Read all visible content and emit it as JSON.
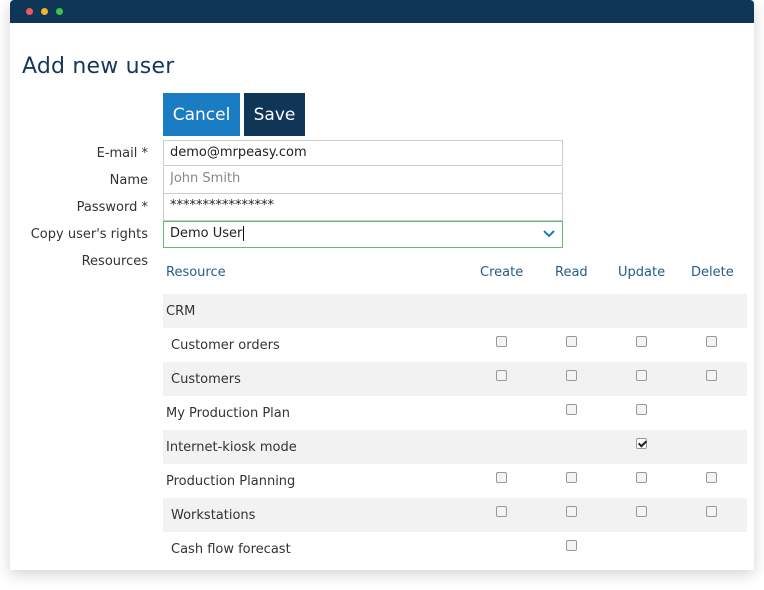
{
  "window": {
    "title_controls": [
      "close",
      "minimize",
      "zoom"
    ]
  },
  "page": {
    "title": "Add new user"
  },
  "toolbar": {
    "cancel_label": "Cancel",
    "save_label": "Save"
  },
  "form": {
    "email_label": "E-mail *",
    "email_value": "demo@mrpeasy.com",
    "name_label": "Name",
    "name_placeholder": "John Smith",
    "password_label": "Password *",
    "password_value": "****************",
    "copy_rights_label": "Copy user's rights",
    "copy_rights_value": "Demo User",
    "resources_label": "Resources"
  },
  "resources_table": {
    "columns": [
      "Resource",
      "Create",
      "Read",
      "Update",
      "Delete"
    ],
    "rows": [
      {
        "label": "CRM",
        "indent": false,
        "checks": [
          null,
          null,
          null,
          null
        ]
      },
      {
        "label": "Customer orders",
        "indent": true,
        "checks": [
          false,
          false,
          false,
          false
        ]
      },
      {
        "label": "Customers",
        "indent": true,
        "checks": [
          false,
          false,
          false,
          false
        ]
      },
      {
        "label": "My Production Plan",
        "indent": false,
        "checks": [
          null,
          false,
          false,
          null
        ]
      },
      {
        "label": "Internet-kiosk mode",
        "indent": false,
        "checks": [
          null,
          null,
          true,
          null
        ]
      },
      {
        "label": "Production Planning",
        "indent": false,
        "checks": [
          false,
          false,
          false,
          false
        ]
      },
      {
        "label": "Workstations",
        "indent": true,
        "checks": [
          false,
          false,
          false,
          false
        ]
      },
      {
        "label": "Cash flow forecast",
        "indent": true,
        "checks": [
          null,
          false,
          null,
          null
        ]
      }
    ]
  },
  "colors": {
    "titlebar": "#0f3557",
    "cancel_button": "#1a7cc3",
    "save_button": "#0f3557",
    "title_text": "#14385c",
    "header_text": "#245d8a",
    "select_border": "#66bb66"
  }
}
